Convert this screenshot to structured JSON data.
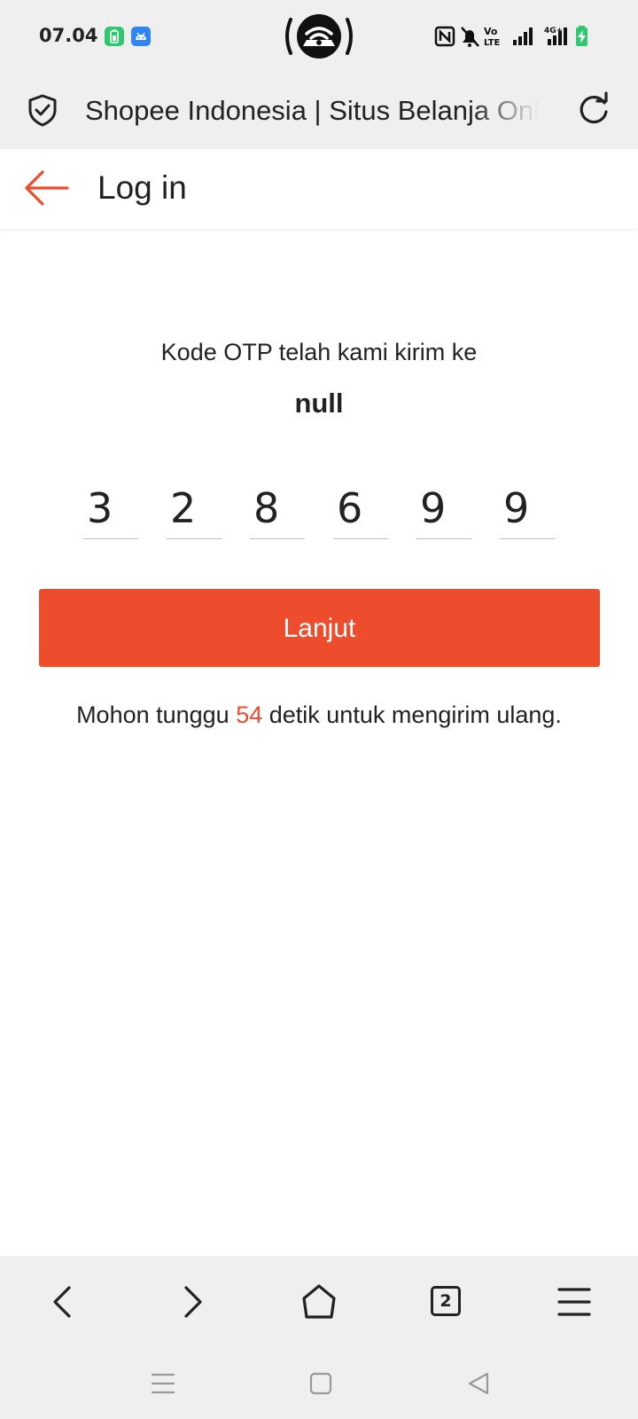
{
  "status_bar": {
    "time": "07.04",
    "icons": [
      "battery-saver-app-icon",
      "android-app-icon",
      "hotspot-icon",
      "nfc-icon",
      "muted-bell-icon",
      "volte-icon",
      "signal-icon",
      "4g-signal-icon",
      "battery-charging-icon"
    ],
    "volte_label_top": "Vo",
    "volte_label_bottom": "LTE",
    "network_label": "4G+"
  },
  "browser": {
    "page_title": "Shopee Indonesia | Situs Belanja Online",
    "tab_count": "2",
    "toolbar_icons": [
      "back-icon",
      "forward-icon",
      "home-icon",
      "tabs-icon",
      "menu-icon"
    ]
  },
  "header": {
    "title": "Log in"
  },
  "otp": {
    "sent_text": "Kode OTP telah kami kirim ke",
    "target": "null",
    "digits": [
      "3",
      "2",
      "8",
      "6",
      "9",
      "9"
    ]
  },
  "continue_button": {
    "label": "Lanjut"
  },
  "resend": {
    "prefix": "Mohon tunggu ",
    "seconds": "54",
    "suffix": " detik untuk mengirim ulang."
  },
  "colors": {
    "accent": "#ee4d2d",
    "chrome_bg": "#efefef",
    "text": "#222222"
  }
}
